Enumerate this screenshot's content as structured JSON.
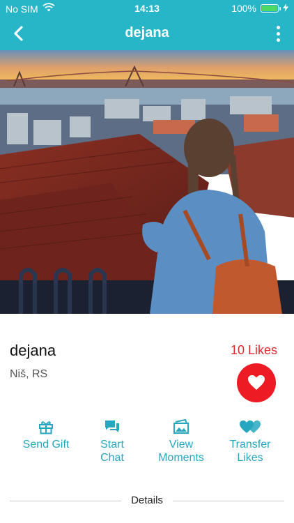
{
  "status_bar": {
    "carrier": "No SIM",
    "time": "14:13",
    "battery_percent": "100%",
    "battery_level": 1.0
  },
  "nav": {
    "title": "dejana",
    "back_icon": "chevron-left-icon",
    "more_icon": "more-vertical-icon"
  },
  "profile": {
    "name": "dejana",
    "location": "Niš, RS",
    "likes_text": "10 Likes"
  },
  "actions": [
    {
      "line1": "Send Gift",
      "line2": "",
      "icon": "gift-icon"
    },
    {
      "line1": "Start",
      "line2": "Chat",
      "icon": "chat-icon"
    },
    {
      "line1": "View",
      "line2": "Moments",
      "icon": "photos-icon"
    },
    {
      "line1": "Transfer",
      "line2": "Likes",
      "icon": "hearts-icon"
    }
  ],
  "details_label": "Details",
  "colors": {
    "accent": "#27b5c8",
    "action_text": "#27a7bf",
    "like_red": "#ec1b24"
  }
}
